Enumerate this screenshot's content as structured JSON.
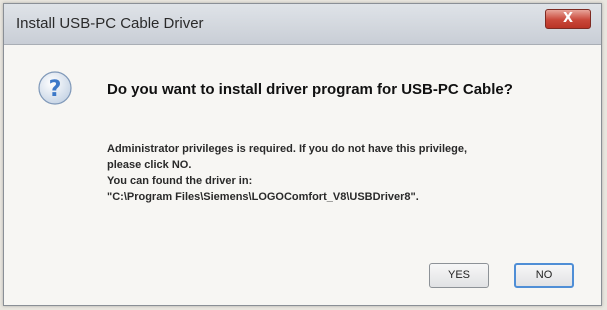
{
  "window": {
    "title": "Install USB-PC Cable Driver",
    "close_glyph": "X"
  },
  "dialog": {
    "icon": "question-icon",
    "question": "Do you want to install driver program for USB-PC Cable?",
    "message_lines": [
      "Administrator privileges is required. If you do not have this privilege,",
      "please click NO.",
      "You can found the driver in:",
      "\"C:\\Program Files\\Siemens\\LOGOComfort_V8\\USBDriver8\"."
    ]
  },
  "buttons": {
    "yes_label": "YES",
    "no_label": "NO"
  },
  "colors": {
    "close_red": "#c9483a",
    "focus_blue": "#4f8ed6",
    "icon_blue": "#3c78c8"
  }
}
